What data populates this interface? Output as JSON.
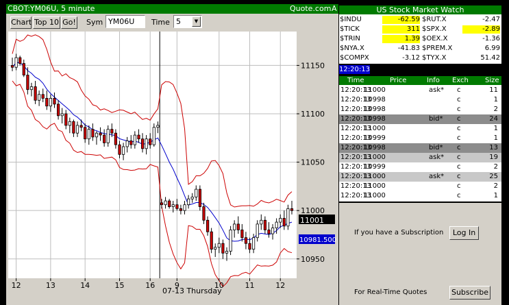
{
  "chart_window": {
    "title": "CBOT:YM06U, 5 minute",
    "source": "Quote.com",
    "corner_letter": "A",
    "buttons": {
      "chart": "Chart",
      "top10": "Top 10",
      "go": "Go!"
    },
    "sym_label": "Sym",
    "sym_value": "YM06U",
    "time_label": "Time",
    "time_value": "5",
    "last_price_tag": "11001",
    "ma_tag": "10981.500",
    "date_label": "07-13 Thursday"
  },
  "chart_data": {
    "type": "candlestick",
    "symbol": "YM06U",
    "interval_minutes": 5,
    "y_ticks": [
      "11150",
      "11100",
      "11050",
      "11000",
      "10950"
    ],
    "x_ticks": [
      "12",
      "13",
      "14",
      "15",
      "16",
      "9",
      "10",
      "11",
      "12"
    ],
    "ylim": [
      10930,
      11185
    ],
    "series": [
      {
        "name": "price",
        "color": "#cc0000"
      },
      {
        "name": "moving average",
        "color": "#0000cc"
      },
      {
        "name": "bollinger bands",
        "color": "#cc0000"
      }
    ],
    "candles": [
      [
        11150,
        11158,
        11144,
        11148
      ],
      [
        11148,
        11162,
        11145,
        11158
      ],
      [
        11158,
        11160,
        11150,
        11152
      ],
      [
        11152,
        11156,
        11138,
        11140
      ],
      [
        11140,
        11148,
        11120,
        11125
      ],
      [
        11125,
        11132,
        11118,
        11128
      ],
      [
        11128,
        11134,
        11110,
        11114
      ],
      [
        11114,
        11124,
        11108,
        11120
      ],
      [
        11120,
        11126,
        11112,
        11116
      ],
      [
        11116,
        11124,
        11104,
        11108
      ],
      [
        11108,
        11120,
        11102,
        11116
      ],
      [
        11116,
        11122,
        11106,
        11110
      ],
      [
        11110,
        11114,
        11094,
        11098
      ],
      [
        11098,
        11106,
        11090,
        11100
      ],
      [
        11100,
        11104,
        11084,
        11088
      ],
      [
        11088,
        11096,
        11080,
        11092
      ],
      [
        11092,
        11094,
        11076,
        11080
      ],
      [
        11080,
        11092,
        11076,
        11088
      ],
      [
        11088,
        11094,
        11082,
        11086
      ],
      [
        11086,
        11090,
        11070,
        11074
      ],
      [
        11074,
        11088,
        11068,
        11084
      ],
      [
        11084,
        11090,
        11072,
        11076
      ],
      [
        11076,
        11082,
        11068,
        11080
      ],
      [
        11080,
        11086,
        11072,
        11078
      ],
      [
        11078,
        11084,
        11066,
        11070
      ],
      [
        11070,
        11088,
        11066,
        11084
      ],
      [
        11084,
        11090,
        11076,
        11080
      ],
      [
        11080,
        11084,
        11064,
        11068
      ],
      [
        11068,
        11072,
        11054,
        11058
      ],
      [
        11058,
        11070,
        11052,
        11066
      ],
      [
        11066,
        11076,
        11060,
        11072
      ],
      [
        11072,
        11078,
        11064,
        11068
      ],
      [
        11068,
        11082,
        11064,
        11078
      ],
      [
        11078,
        11084,
        11070,
        11074
      ],
      [
        11074,
        11080,
        11060,
        11064
      ],
      [
        11064,
        11078,
        11058,
        11074
      ],
      [
        11074,
        11080,
        11064,
        11068
      ],
      [
        11068,
        11090,
        11066,
        11086
      ],
      [
        11086,
        11092,
        11080,
        11088
      ],
      [
        11008,
        11012,
        11002,
        11006
      ],
      [
        11006,
        11014,
        11002,
        11010
      ],
      [
        11010,
        11012,
        11002,
        11004
      ],
      [
        11004,
        11010,
        10998,
        11006
      ],
      [
        11006,
        11012,
        11000,
        11002
      ],
      [
        11002,
        11006,
        10996,
        11000
      ],
      [
        11000,
        11010,
        10996,
        11006
      ],
      [
        11006,
        11016,
        11002,
        11012
      ],
      [
        11012,
        11018,
        11008,
        11014
      ],
      [
        11014,
        11026,
        11010,
        11022
      ],
      [
        11022,
        11026,
        11000,
        11004
      ],
      [
        11004,
        11008,
        10986,
        10990
      ],
      [
        10990,
        10994,
        10974,
        10978
      ],
      [
        10978,
        10982,
        10956,
        10960
      ],
      [
        10960,
        10966,
        10952,
        10962
      ],
      [
        10962,
        10972,
        10956,
        10966
      ],
      [
        10966,
        10970,
        10950,
        10956
      ],
      [
        10956,
        10962,
        10948,
        10958
      ],
      [
        10958,
        10984,
        10954,
        10980
      ],
      [
        10980,
        10990,
        10972,
        10986
      ],
      [
        10986,
        10994,
        10976,
        10980
      ],
      [
        10980,
        10986,
        10968,
        10972
      ],
      [
        10972,
        10978,
        10960,
        10966
      ],
      [
        10966,
        10972,
        10956,
        10960
      ],
      [
        10960,
        10976,
        10956,
        10972
      ],
      [
        10972,
        10990,
        10968,
        10986
      ],
      [
        10986,
        10996,
        10980,
        10990
      ],
      [
        10990,
        10994,
        10976,
        10980
      ],
      [
        10980,
        10988,
        10972,
        10976
      ],
      [
        10976,
        10986,
        10970,
        10982
      ],
      [
        10982,
        10992,
        10976,
        10988
      ],
      [
        10988,
        10996,
        10982,
        10992
      ],
      [
        10992,
        11000,
        10980,
        10984
      ],
      [
        10984,
        11006,
        10980,
        11002
      ],
      [
        11002,
        11010,
        10996,
        11000
      ]
    ]
  },
  "watch": {
    "title": "US Stock Market Watch",
    "left": [
      {
        "sym": "$INDU",
        "val": "-62.59",
        "hl": true
      },
      {
        "sym": "$TICK",
        "val": "311",
        "hl": true
      },
      {
        "sym": "$TRIN",
        "val": "1.39",
        "hl": true
      },
      {
        "sym": "$NYA.X",
        "val": "-41.83",
        "hl": false
      },
      {
        "sym": "$COMPX",
        "val": "-3.12",
        "hl": false
      }
    ],
    "right": [
      {
        "sym": "$RUT.X",
        "val": "-2.47",
        "hl": false
      },
      {
        "sym": "$SPX.X",
        "val": "-2.89",
        "hl": true
      },
      {
        "sym": "$OEX.X",
        "val": "-1.36",
        "hl": false
      },
      {
        "sym": "$PREM.X",
        "val": "6.99",
        "hl": false
      },
      {
        "sym": "$TYX.X",
        "val": "51.42",
        "hl": false
      }
    ],
    "clock": "12:20:13"
  },
  "trades": {
    "headers": [
      "Time",
      "Price",
      "Info",
      "Exch",
      "Size"
    ],
    "rows": [
      {
        "time": "12:20:13",
        "price": "11000",
        "info": "ask*",
        "exch": "c",
        "size": "11",
        "bg": "#ffffff"
      },
      {
        "time": "12:20:13",
        "price": "10998",
        "info": "",
        "exch": "c",
        "size": "1",
        "bg": "#ffffff"
      },
      {
        "time": "12:20:13",
        "price": "10998",
        "info": "",
        "exch": "c",
        "size": "2",
        "bg": "#ffffff"
      },
      {
        "time": "12:20:13",
        "price": "10998",
        "info": "bid*",
        "exch": "c",
        "size": "24",
        "bg": "#8c8c8c"
      },
      {
        "time": "12:20:13",
        "price": "11000",
        "info": "",
        "exch": "c",
        "size": "1",
        "bg": "#ffffff"
      },
      {
        "time": "12:20:13",
        "price": "10999",
        "info": "",
        "exch": "c",
        "size": "1",
        "bg": "#ffffff"
      },
      {
        "time": "12:20:13",
        "price": "10998",
        "info": "bid*",
        "exch": "c",
        "size": "13",
        "bg": "#8c8c8c"
      },
      {
        "time": "12:20:13",
        "price": "11000",
        "info": "ask*",
        "exch": "c",
        "size": "19",
        "bg": "#c8c8c8"
      },
      {
        "time": "12:20:13",
        "price": "10999",
        "info": "",
        "exch": "c",
        "size": "2",
        "bg": "#ffffff"
      },
      {
        "time": "12:20:13",
        "price": "11000",
        "info": "ask*",
        "exch": "c",
        "size": "25",
        "bg": "#c8c8c8"
      },
      {
        "time": "12:20:13",
        "price": "11000",
        "info": "",
        "exch": "c",
        "size": "2",
        "bg": "#ffffff"
      },
      {
        "time": "12:20:13",
        "price": "11000",
        "info": "",
        "exch": "c",
        "size": "1",
        "bg": "#ffffff"
      }
    ]
  },
  "promo": {
    "subscription_text": "If you have a Subscription",
    "login_button": "Log In",
    "realtime_text": "For Real-Time Quotes",
    "subscribe_button": "Subscribe"
  }
}
